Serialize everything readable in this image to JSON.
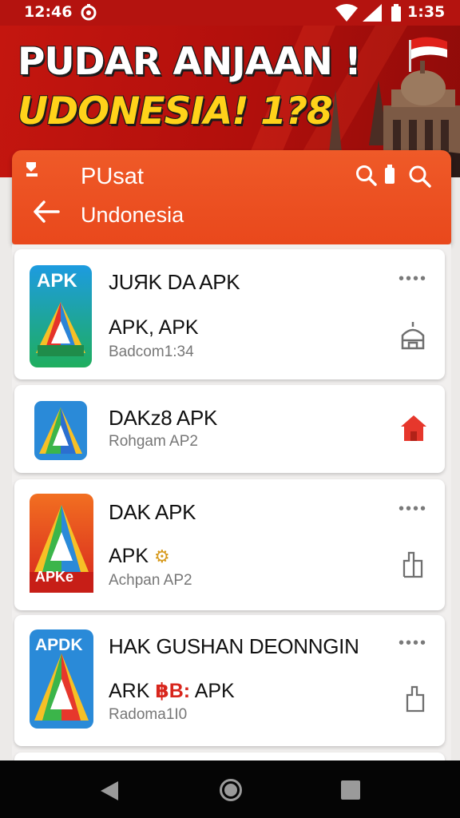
{
  "status_bar": {
    "time_left": "12:46",
    "time_right": "1:35"
  },
  "hero": {
    "title_line1": "PUDAR ANJAAN !",
    "title_line2": "UDONESIA! 1?8"
  },
  "app_bar": {
    "title": "PUsat",
    "subtitle": "Undonesia"
  },
  "list": {
    "items": [
      {
        "icon_label": "APK",
        "name": "JUЯK DA APK",
        "subtitle": "APK, APK",
        "desc": "Badcom1:34",
        "has_more": true,
        "action_icon": "mosque-outline-icon"
      },
      {
        "icon_label": "",
        "name": "DAK&#8203;z8 APK",
        "subtitle": "",
        "desc": "Rohgam AP2",
        "has_more": false,
        "action_icon": "home-red-icon"
      },
      {
        "icon_label": "APKe",
        "name": "DAK APK",
        "subtitle": "APK",
        "desc": "Achpan AP2",
        "has_more": true,
        "action_icon": "book-icon"
      },
      {
        "icon_label": "APDK",
        "name": "HAK GUSHAN DEONNGIN",
        "subtitle_pre": "ARK ",
        "subtitle_hl": "&#3647;B:",
        "subtitle_post": " APK",
        "desc": "Radoma1I0",
        "has_more": true,
        "action_icon": "share-icon"
      }
    ]
  },
  "more_glyph": "••••",
  "colors": {
    "status_bar": "#b4130f",
    "hero": "#c4160f",
    "app_bar": "#e9481c",
    "accent_yellow": "#ffd21a",
    "nav_bar": "#050505"
  }
}
